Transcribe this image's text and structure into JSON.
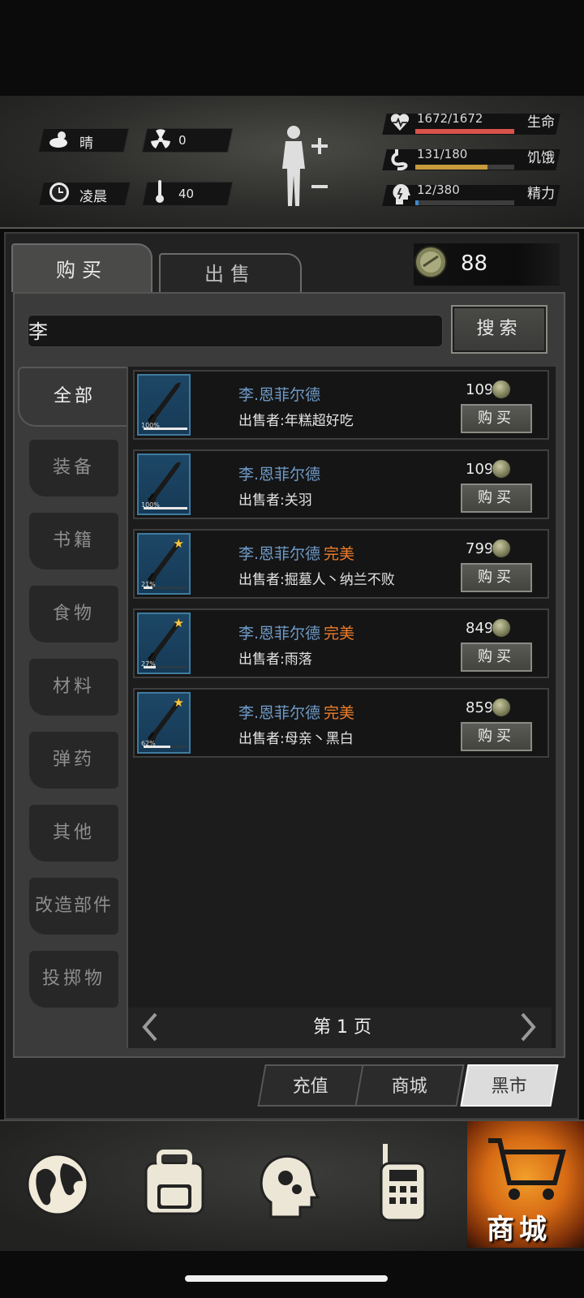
{
  "weather": {
    "condition": "晴",
    "radiation": "0",
    "time_of_day": "凌晨",
    "temperature": "40"
  },
  "stats": [
    {
      "icon": "heart-icon",
      "value": "1672/1672",
      "label": "生命",
      "fraction": 1.0,
      "color": "#d9534a"
    },
    {
      "icon": "stomach-icon",
      "value": "131/180",
      "label": "饥饿",
      "fraction": 0.728,
      "color": "#c79a3e"
    },
    {
      "icon": "brain-icon",
      "value": "12/380",
      "label": "精力",
      "fraction": 0.032,
      "color": "#3a8ad0"
    }
  ],
  "market": {
    "tabs": {
      "buy": "购买",
      "sell": "出售"
    },
    "currency": "88",
    "search": {
      "value": "李",
      "button": "搜索"
    },
    "categories": [
      "全部",
      "装备",
      "书籍",
      "食物",
      "材料",
      "弹药",
      "其他",
      "改造部件",
      "投掷物"
    ],
    "items": [
      {
        "name": "李.恩菲尔德",
        "quality": "",
        "seller": "出售者:年糕超好吃",
        "price": "109",
        "durability": "100%",
        "durability_fraction": 1.0,
        "starred": false,
        "buy": "购买"
      },
      {
        "name": "李.恩菲尔德",
        "quality": "",
        "seller": "出售者:关羽",
        "price": "109",
        "durability": "100%",
        "durability_fraction": 1.0,
        "starred": false,
        "buy": "购买"
      },
      {
        "name": "李.恩菲尔德",
        "quality": "完美",
        "seller": "出售者:掘墓人丶纳兰不败",
        "price": "799",
        "durability": "21%",
        "durability_fraction": 0.21,
        "starred": true,
        "buy": "购买"
      },
      {
        "name": "李.恩菲尔德",
        "quality": "完美",
        "seller": "出售者:雨落",
        "price": "849",
        "durability": "27%",
        "durability_fraction": 0.27,
        "starred": true,
        "buy": "购买"
      },
      {
        "name": "李.恩菲尔德",
        "quality": "完美",
        "seller": "出售者:母亲丶黑白",
        "price": "859",
        "durability": "62%",
        "durability_fraction": 0.62,
        "starred": true,
        "buy": "购买"
      }
    ],
    "pager": {
      "label": "第 1 页"
    },
    "bottom_tabs": [
      "充值",
      "商城",
      "黑市"
    ]
  },
  "nav": {
    "items": [
      "globe-icon",
      "backpack-icon",
      "skills-head-icon",
      "walkie-talkie-icon",
      "shop-cart-icon"
    ],
    "shop_label": "商城"
  }
}
